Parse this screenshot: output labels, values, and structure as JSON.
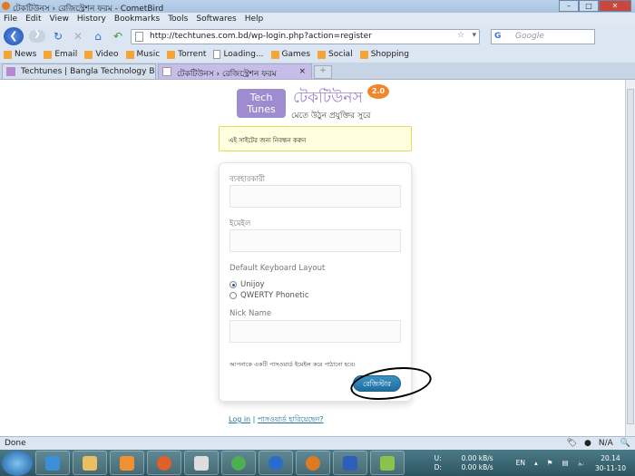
{
  "window": {
    "title": "টেকটিউনস › রেজিস্ট্রেশন ফরম - CometBird",
    "controls": [
      "–",
      "□",
      "✕"
    ]
  },
  "menu": [
    "File",
    "Edit",
    "View",
    "History",
    "Bookmarks",
    "Tools",
    "Softwares",
    "Help"
  ],
  "nav": {
    "url": "http://techtunes.com.bd/wp-login.php?action=register",
    "search_placeholder": "Google",
    "search_engine": "G"
  },
  "bookmarks": [
    {
      "label": "News",
      "icon": "rss"
    },
    {
      "label": "Email",
      "icon": "rss"
    },
    {
      "label": "Video",
      "icon": "rss"
    },
    {
      "label": "Music",
      "icon": "rss"
    },
    {
      "label": "Torrent",
      "icon": "rss"
    },
    {
      "label": "Loading...",
      "icon": "page"
    },
    {
      "label": "Games",
      "icon": "rss"
    },
    {
      "label": "Social",
      "icon": "rss"
    },
    {
      "label": "Shopping",
      "icon": "rss"
    }
  ],
  "tabs": [
    {
      "label": "Techtunes | Bangla Technology Bloggi..."
    },
    {
      "label": "টেকটিউনস › রেজিস্ট্রেশন ফরম",
      "close": "×"
    }
  ],
  "newtab": "+",
  "logo": {
    "box": "Tech Tunes",
    "name": "টেকটিউনস",
    "tagline": "মেতে উঠুন প্রযুক্তির সুরে",
    "version": "2.0"
  },
  "notice": "এই সাইটের জন্য নিবন্ধন করুন",
  "form": {
    "username_label": "ব্যবহারকারী",
    "email_label": "ইমেইল",
    "layout_label": "Default Keyboard Layout",
    "options": [
      {
        "label": "Unijoy",
        "checked": true
      },
      {
        "label": "QWERTY Phonetic",
        "checked": false
      }
    ],
    "nick_label": "Nick Name",
    "message": "আপনাকে একটি পাসওয়ার্ড ইমেইল করে পাঠানো হবে।",
    "submit": "রেজিস্টার"
  },
  "links": {
    "login": "Log in",
    "sep": "|",
    "lost": "পাসওয়ার্ড হারিয়েছেন?"
  },
  "status": {
    "text": "Done",
    "na": "N/A"
  },
  "tray": {
    "lang": "EN",
    "up_label": "U:",
    "up": "0.00 kB/s",
    "down_label": "D:",
    "down": "0.00 kB/s",
    "time": "20.14",
    "date": "30-11-10"
  }
}
